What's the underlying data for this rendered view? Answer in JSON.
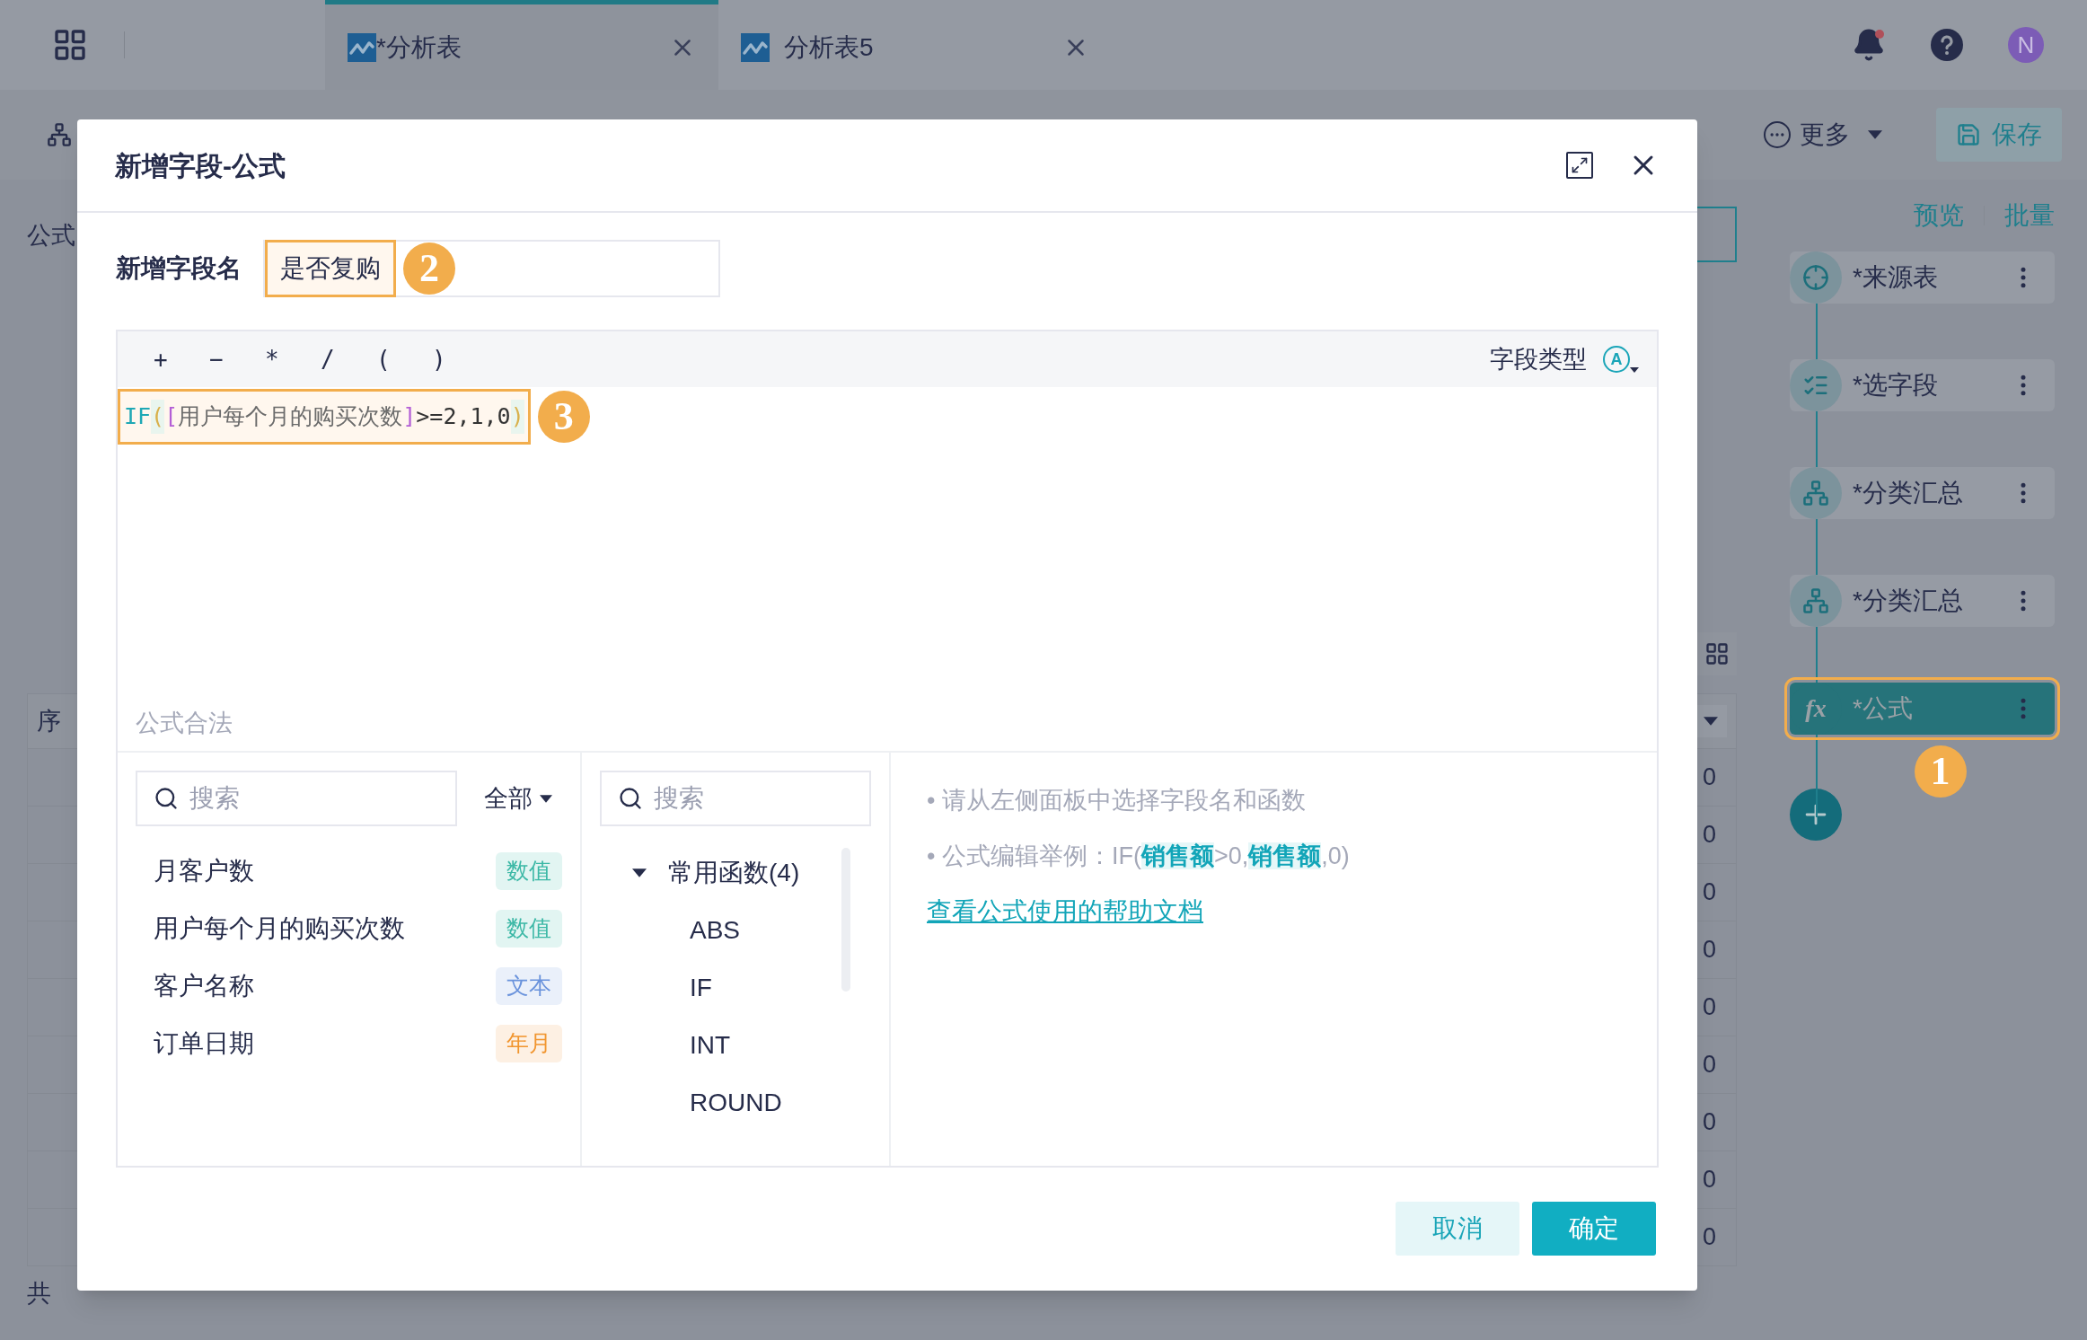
{
  "top_bar": {
    "tabs": [
      {
        "label": "*分析表",
        "selected": true
      },
      {
        "label": "分析表5",
        "selected": false
      }
    ],
    "notification_dot": true,
    "avatar": "N"
  },
  "toolbar": {
    "more": "更多",
    "save": "保存"
  },
  "background": {
    "formula_label": "公式",
    "column_header": "序",
    "last_column_values": [
      "0",
      "0",
      "0",
      "0",
      "0",
      "0",
      "0",
      "0",
      "0"
    ],
    "footer_prefix": "共"
  },
  "steps_panel": {
    "links": [
      "预览",
      "批量"
    ],
    "steps": [
      {
        "label": "*来源表",
        "kind": "source",
        "selected": false
      },
      {
        "label": "*选字段",
        "kind": "select",
        "selected": false
      },
      {
        "label": "*分类汇总",
        "kind": "group",
        "selected": false
      },
      {
        "label": "*分类汇总",
        "kind": "group",
        "selected": false
      },
      {
        "label": "*公式",
        "kind": "formula",
        "icon_text": "fx",
        "selected": true,
        "marker": "1"
      }
    ]
  },
  "dialog": {
    "title": "新增字段-公式",
    "name_label": "新增字段名",
    "name_value": "是否复购",
    "name_marker": "2",
    "operators": [
      "+",
      "−",
      "*",
      "/",
      "(",
      ")"
    ],
    "field_type_label": "字段类型",
    "field_type_icon": "A",
    "formula": [
      {
        "text": "IF",
        "kind": "function"
      },
      {
        "text": "(",
        "kind": "paren"
      },
      {
        "text": "[",
        "kind": "bracket"
      },
      {
        "text": "用户每个月的购买次数",
        "kind": "field"
      },
      {
        "text": "]",
        "kind": "bracket"
      },
      {
        "text": ">=2,1,0",
        "kind": "plain"
      },
      {
        "text": ")",
        "kind": "paren"
      }
    ],
    "formula_marker": "3",
    "status": "公式合法",
    "fields_search_placeholder": "搜索",
    "filter": "全部",
    "fields": [
      {
        "name": "月客户数",
        "type": "数值",
        "kind": "number"
      },
      {
        "name": "用户每个月的购买次数",
        "type": "数值",
        "kind": "number"
      },
      {
        "name": "客户名称",
        "type": "文本",
        "kind": "text"
      },
      {
        "name": "订单日期",
        "type": "年月",
        "kind": "date"
      }
    ],
    "functions_search_placeholder": "搜索",
    "function_group": {
      "label": "常用函数(4)",
      "expanded": true,
      "children": [
        "ABS",
        "IF",
        "INT",
        "ROUND"
      ]
    },
    "hints": [
      [
        {
          "text": "• 请从左侧面板中选择字段名和函数",
          "kind": "plain"
        }
      ],
      [
        {
          "text": "• 公式编辑举例：IF(",
          "kind": "plain"
        },
        {
          "text": "销售额",
          "kind": "field"
        },
        {
          "text": ">0,",
          "kind": "plain"
        },
        {
          "text": "销售额",
          "kind": "field"
        },
        {
          "text": ",0)",
          "kind": "plain"
        }
      ]
    ],
    "help_link": "查看公式使用的帮助文档",
    "buttons": [
      {
        "label": "取消",
        "kind": "secondary"
      },
      {
        "label": "确定",
        "kind": "primary"
      }
    ]
  }
}
